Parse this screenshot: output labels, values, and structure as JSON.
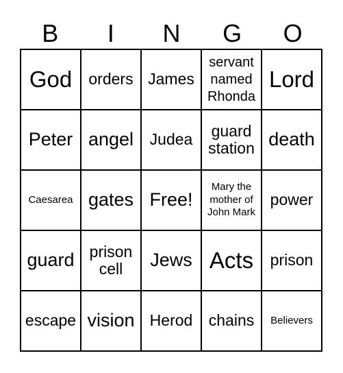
{
  "header": [
    "B",
    "I",
    "N",
    "G",
    "O"
  ],
  "rows": [
    [
      {
        "t": "God",
        "c": "xl"
      },
      {
        "t": "orders",
        "c": "m"
      },
      {
        "t": "James",
        "c": "m"
      },
      {
        "t": "servant named Rhonda",
        "c": "s"
      },
      {
        "t": "Lord",
        "c": "xl"
      }
    ],
    [
      {
        "t": "Peter",
        "c": "l"
      },
      {
        "t": "angel",
        "c": "l"
      },
      {
        "t": "Judea",
        "c": "m"
      },
      {
        "t": "guard station",
        "c": "m"
      },
      {
        "t": "death",
        "c": "l"
      }
    ],
    [
      {
        "t": "Caesarea",
        "c": "xs"
      },
      {
        "t": "gates",
        "c": "l"
      },
      {
        "t": "Free!",
        "c": "l"
      },
      {
        "t": "Mary the mother of John Mark",
        "c": "xs"
      },
      {
        "t": "power",
        "c": "m"
      }
    ],
    [
      {
        "t": "guard",
        "c": "l"
      },
      {
        "t": "prison cell",
        "c": "m"
      },
      {
        "t": "Jews",
        "c": "l"
      },
      {
        "t": "Acts",
        "c": "xl"
      },
      {
        "t": "prison",
        "c": "m"
      }
    ],
    [
      {
        "t": "escape",
        "c": "m"
      },
      {
        "t": "vision",
        "c": "l"
      },
      {
        "t": "Herod",
        "c": "m"
      },
      {
        "t": "chains",
        "c": "m"
      },
      {
        "t": "Believers",
        "c": "xs"
      }
    ]
  ]
}
